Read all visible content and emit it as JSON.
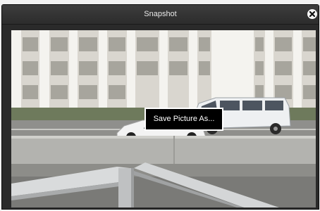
{
  "dialog": {
    "title": "Snapshot",
    "close_icon": "close-icon"
  },
  "snapshot": {
    "description_icon": "snapshot-image"
  },
  "context_menu": {
    "items": [
      {
        "label": "Save Picture As..."
      }
    ]
  }
}
